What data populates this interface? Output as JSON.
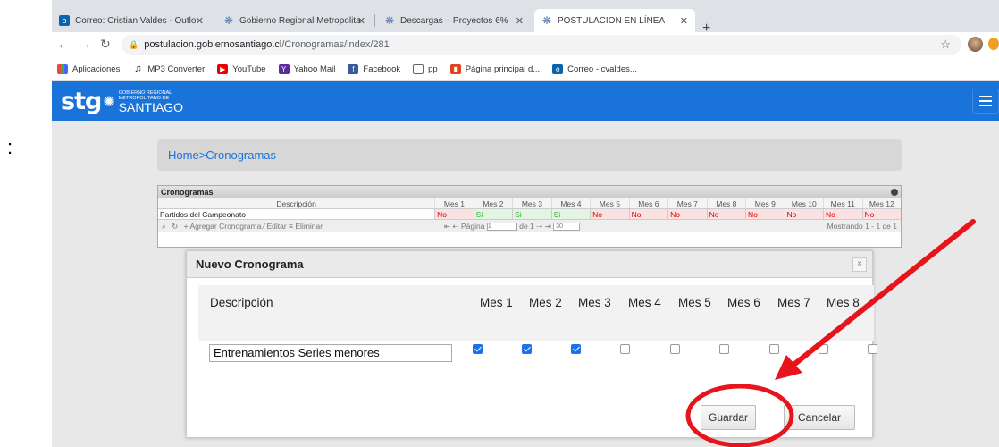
{
  "side_mark": ":",
  "browser": {
    "tabs": [
      {
        "title": "Correo: Cristian Valdes - Outlo",
        "icon": "outlook-icon"
      },
      {
        "title": "Gobierno Regional Metropolita",
        "icon": "stg-icon"
      },
      {
        "title": "Descargas – Proyectos 6%",
        "icon": "stg-icon"
      },
      {
        "title": "POSTULACION EN LÍNEA",
        "icon": "stg-icon"
      }
    ],
    "new_tab": "+",
    "url_host": "postulacion.gobiernosantiago.cl",
    "url_path": "/Cronogramas/index/281",
    "bookmarks": [
      "Aplicaciones",
      "MP3 Converter",
      "YouTube",
      "Yahoo Mail",
      "Facebook",
      "pp",
      "Página principal d...",
      "Correo - cvaldes..."
    ]
  },
  "site": {
    "logo_text": "stg",
    "logo_small": "GOBIERNO REGIONAL METROPOLITANO DE",
    "logo_big": "SANTIAGO",
    "accent": "#1a73d9"
  },
  "breadcrumb": {
    "home": "Home",
    "sep": ">",
    "current": "Cronogramas"
  },
  "grid": {
    "caption": "Cronogramas",
    "desc_header": "Descripción",
    "month_headers": [
      "Mes 1",
      "Mes 2",
      "Mes 3",
      "Mes 4",
      "Mes 5",
      "Mes 6",
      "Mes 7",
      "Mes 8",
      "Mes 9",
      "Mes 10",
      "Mes 11",
      "Mes 12"
    ],
    "rows": [
      {
        "desc": "Partidos del Campeonato",
        "months": [
          "No",
          "Si",
          "Si",
          "Si",
          "No",
          "No",
          "No",
          "No",
          "No",
          "No",
          "No",
          "No"
        ]
      }
    ],
    "pager_left": "+ Agregar Cronograma  ⁄ Editar  ≡ Eliminar",
    "pager_page_label": "Página",
    "pager_page_value": "1",
    "pager_of": "de 1",
    "pager_rows": "30",
    "pager_right": "Mostrando 1 - 1 de 1"
  },
  "modal": {
    "title": "Nuevo Cronograma",
    "close": "×",
    "desc_header": "Descripción",
    "month_headers": [
      "Mes 1",
      "Mes 2",
      "Mes 3",
      "Mes 4",
      "Mes 5",
      "Mes 6",
      "Mes 7",
      "Mes 8"
    ],
    "desc_value": "Entrenamientos Series menores",
    "checked": [
      true,
      true,
      true,
      false,
      false,
      false,
      false,
      false,
      false
    ],
    "save_label": "Guardar",
    "cancel_label": "Cancelar"
  },
  "annotation_color": "#e8141c"
}
